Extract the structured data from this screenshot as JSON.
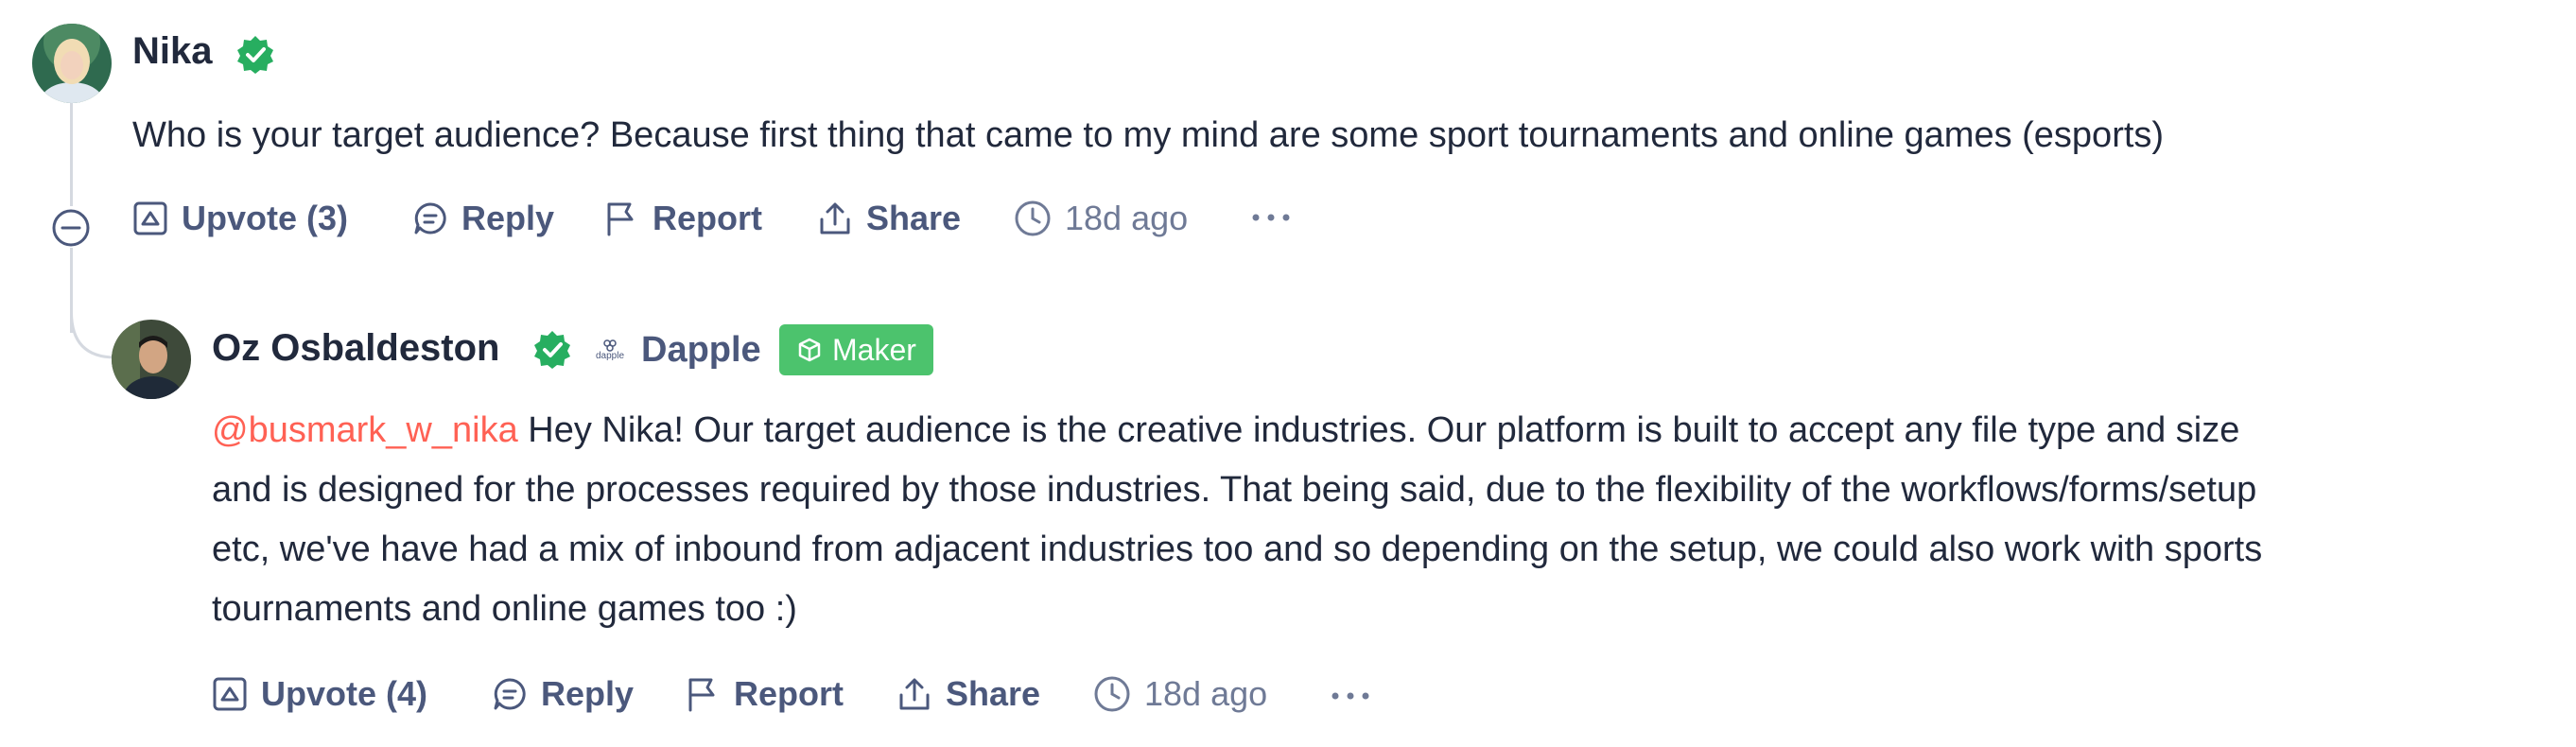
{
  "comments": [
    {
      "author": "Nika",
      "text": "Who is your target audience? Because first thing that came to my mind are some sport tournaments and online games (esports)",
      "actions": {
        "upvote": "Upvote (3)",
        "reply": "Reply",
        "report": "Report",
        "share": "Share",
        "time": "18d ago"
      }
    },
    {
      "author": "Oz Osbaldeston",
      "company": "Dapple",
      "company_logo_text": "dapple",
      "badge": "Maker",
      "mention": "@busmark_w_nika",
      "text_line1": " Hey Nika! Our target audience is the creative industries. Our platform is built to accept any file type and size",
      "text_line2": "and is designed for the processes required by those industries. That being said, due to the flexibility of the workflows/forms/setup",
      "text_line3": "etc, we've have had a mix of inbound from adjacent industries too and so depending on the setup, we could also work with sports",
      "text_line4": "tournaments and online games too :)",
      "actions": {
        "upvote": "Upvote (4)",
        "reply": "Reply",
        "report": "Report",
        "share": "Share",
        "time": "18d ago"
      }
    }
  ],
  "colors": {
    "verified": "#27ae60",
    "maker_badge": "#4cc36d",
    "mention": "#ff6154",
    "action_text": "#4b587c"
  }
}
